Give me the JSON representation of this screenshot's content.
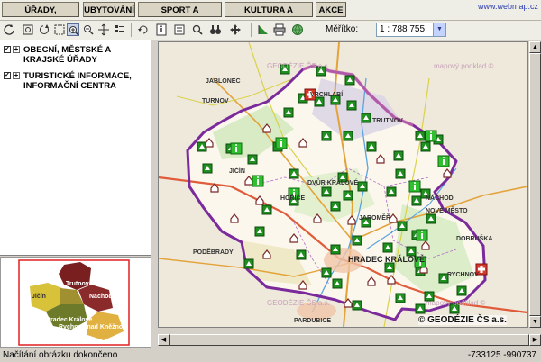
{
  "menu": {
    "items": [
      "ÚŘADY, INSTITUCE",
      "UBYTOVÁNÍ",
      "SPORT A TURISTIKA",
      "KULTURA A PŘÍRODA",
      "AKCE"
    ],
    "brand_link": "www.webmap.cz"
  },
  "toolbar": {
    "scale_label": "Měřítko:",
    "scale_value": "1 : 788 755",
    "tools": [
      "back-icon",
      "zoom-extent-icon",
      "refresh-icon",
      "zoom-in-icon",
      "zoom-out-icon",
      "zoom-window-icon",
      "layers-list-icon",
      "rotate-icon",
      "info-icon",
      "measure-icon",
      "search-icon",
      "binoculars-icon",
      "pan-icon",
      "flag-icon",
      "print-icon",
      "globe-icon"
    ]
  },
  "layers": [
    {
      "label": "OBECNÍ, MĚSTSKÉ A KRAJSKÉ ÚŘADY",
      "checked": true
    },
    {
      "label": "TURISTICKÉ INFORMACE, INFORMAČNÍ CENTRA",
      "checked": true
    }
  ],
  "overview": {
    "regions": [
      "Trutnov",
      "Jičín",
      "Náchod",
      "Hradec Králové",
      "Rychnov nad Kněžnou"
    ],
    "colors": {
      "Trutnov": "#7a1f1f",
      "Jičín": "#d8c23a",
      "Náchod": "#8b2a2a",
      "Hradec Králové": "#6d7a2a",
      "Rychnov nad Kněžnou": "#e0b040"
    }
  },
  "map": {
    "watermarks": [
      "GEODÉZIE ČS a.s.",
      "mapový podklad ©",
      "GEODÉZIE ČS a.s.",
      "mapový podklad ©"
    ],
    "copyright": "© GEODÉZIE ČS a.s.",
    "towns": [
      "TRUTNOV",
      "JIČÍN",
      "DVŮR KRÁLOVÉ",
      "JAROMĚŘ",
      "NÁCHOD",
      "HRADEC KRÁLOVÉ",
      "PARDUBICE",
      "RYCHNOV",
      "PODĚBRADY",
      "NOVÉ MĚSTO",
      "DOBRUŠKA",
      "HOŘICE",
      "VRCHLABÍ",
      "JABLONEC",
      "TURNOV"
    ]
  },
  "status": {
    "text": "Načítání obrázku dokončeno",
    "coords": "-733125 -990737"
  },
  "colors": {
    "region_border": "#7b2a9c",
    "poi_green": "#1f8f1f",
    "poi_red": "#d83a2a"
  }
}
